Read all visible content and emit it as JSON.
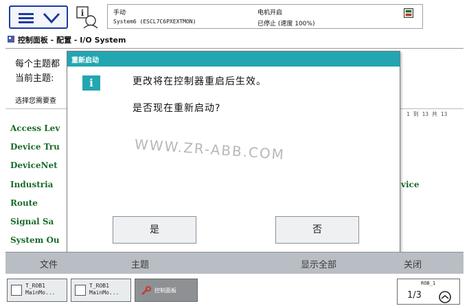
{
  "status": {
    "mode": "手动",
    "system": "System6 (ESCL7C6PXEXTMON)",
    "motors": "电机开启",
    "state": "已停止 (速度 100%)"
  },
  "breadcrumb": "控制面板 - 配置 - I/O System",
  "background": {
    "topic_header": "每个主题都",
    "current_topic": "当前主题:",
    "select_hint": "选择您需要查",
    "pager": "1 到 13 共 13",
    "items": [
      "Access Lev",
      "Device Tru",
      "DeviceNet",
      "Industria",
      "Route",
      "Signal Sa",
      "System Ou"
    ],
    "right_item": "vice"
  },
  "dialog": {
    "title": "重新启动",
    "line1": "更改将在控制器重启后生效。",
    "line2": "是否现在重新启动?",
    "yes": "是",
    "no": "否"
  },
  "watermark": "WWW.ZR-ABB.COM",
  "commands": {
    "file": "文件",
    "topic": "主题",
    "show_all": "显示全部",
    "close": "关闭"
  },
  "taskbar": {
    "task1_line1": "T_ROB1",
    "task1_line2": "MainMo...",
    "task2_line1": "T_ROB1",
    "task2_line2": "MainMo...",
    "control_panel": "控制面板",
    "rob_label": "ROB_1",
    "fraction": "1/3"
  },
  "colors": {
    "dialog_title": "#23a6b0",
    "link_green": "#1a6b2a",
    "menu_blue": "#1a3aa0"
  }
}
